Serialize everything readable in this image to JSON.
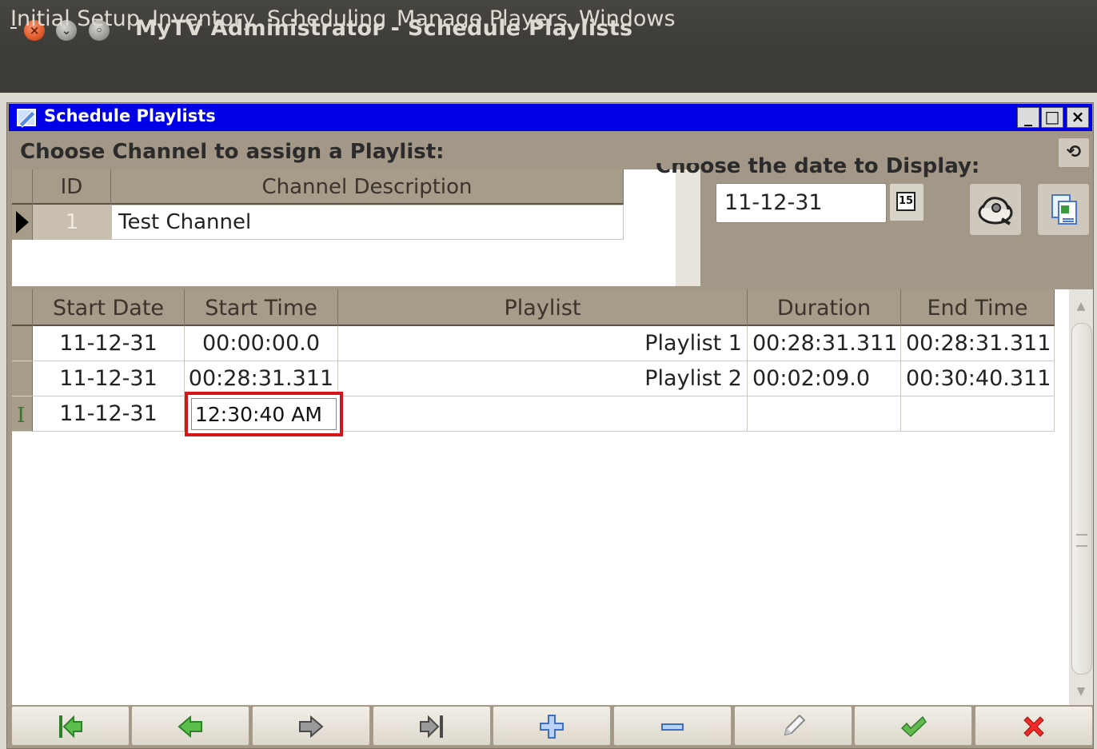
{
  "window": {
    "title": "MyTV Administrator - Schedule Playlists",
    "controls": [
      "close",
      "minimize",
      "maximize"
    ]
  },
  "menubar": {
    "items": [
      {
        "first": "I",
        "rest": "nitial Setup"
      },
      {
        "label": "Inventory"
      },
      {
        "label": "Scheduling"
      },
      {
        "label": "Manage Players"
      },
      {
        "label": "Windows"
      }
    ]
  },
  "internal_frame": {
    "title": "Schedule Playlists",
    "buttons": [
      "minimize",
      "maximize",
      "close"
    ]
  },
  "channel_section": {
    "label": "Choose Channel to assign a Playlist:",
    "columns": [
      "ID",
      "Channel Description"
    ],
    "rows": [
      {
        "id": "1",
        "description": "Test Channel",
        "selected": true
      }
    ]
  },
  "date_section": {
    "label": "Choose the date to Display:",
    "value": "11-12-31",
    "calendar_icon_text": "15",
    "buttons": [
      "print-preview-icon",
      "export-icon"
    ]
  },
  "schedule_grid": {
    "columns": [
      "Start Date",
      "Start Time",
      "Playlist",
      "Duration",
      "End Time"
    ],
    "rows": [
      {
        "start_date": "11-12-31",
        "start_time": "00:00:00.0",
        "playlist": "Playlist 1",
        "duration": "00:28:31.311",
        "end_time": "00:28:31.311"
      },
      {
        "start_date": "11-12-31",
        "start_time": "00:28:31.311",
        "playlist": "Playlist 2",
        "duration": "00:02:09.0",
        "end_time": "00:30:40.311"
      },
      {
        "start_date": "11-12-31",
        "start_time": "12:30:40 AM",
        "playlist": "",
        "duration": "",
        "end_time": "",
        "editing": true
      }
    ]
  },
  "navigator": {
    "buttons": [
      {
        "name": "first-record",
        "color": "#3fa63c"
      },
      {
        "name": "prior-record",
        "color": "#3fa63c"
      },
      {
        "name": "next-record",
        "color": "#7a7a7a"
      },
      {
        "name": "last-record",
        "color": "#7a7a7a"
      },
      {
        "name": "insert-record",
        "color": "#3d6fc4"
      },
      {
        "name": "delete-record",
        "color": "#3d6fc4"
      },
      {
        "name": "edit-record",
        "color": "#8a8a8a"
      },
      {
        "name": "post-record",
        "color": "#4aa43a"
      },
      {
        "name": "cancel-record",
        "color": "#e02020"
      }
    ]
  },
  "colors": {
    "title_bar": "#3c3b37",
    "internal_title": "#0000e6",
    "panel": "#a39887",
    "edit_highlight": "#d5141b"
  }
}
